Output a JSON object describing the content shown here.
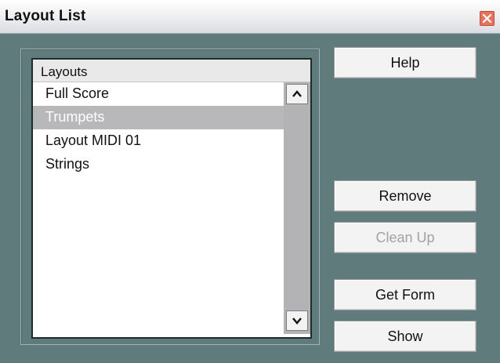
{
  "window": {
    "title": "Layout List"
  },
  "list": {
    "header": "Layouts",
    "items": [
      {
        "label": "Full Score",
        "selected": false
      },
      {
        "label": "Trumpets",
        "selected": true
      },
      {
        "label": "Layout MIDI 01",
        "selected": false
      },
      {
        "label": "Strings",
        "selected": false
      }
    ]
  },
  "buttons": {
    "help": "Help",
    "remove": "Remove",
    "clean_up": "Clean Up",
    "get_form": "Get Form",
    "show": "Show"
  },
  "icons": {
    "close": "close-icon",
    "scroll_up": "chevron-up-icon",
    "scroll_down": "chevron-down-icon"
  },
  "colors": {
    "dialog_bg": "#5f7b7c",
    "selection": "#b8b8bb",
    "close_button": "#e5735e",
    "disabled_text": "#a2a2a2"
  }
}
